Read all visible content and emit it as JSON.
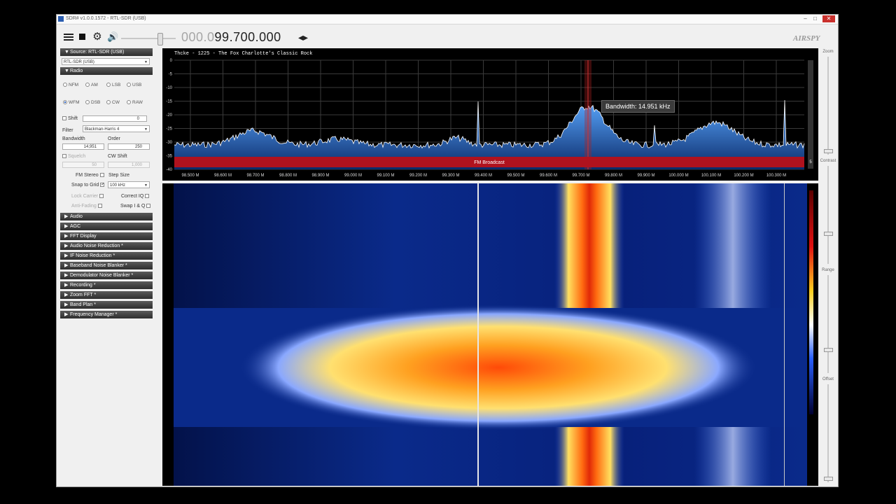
{
  "window": {
    "title": "SDR# v1.0.0.1572 - RTL-SDR (USB)",
    "minimize": "–",
    "maximize": "□",
    "close": "✕"
  },
  "toolbar": {
    "freq_dim": "000.0",
    "freq_bright": "99.700.000",
    "freq_arrows": "◂▸",
    "gear": "⚙",
    "speaker": "🔊"
  },
  "logo": "AIRSPY",
  "source": {
    "header": "Source: RTL-SDR (USB)",
    "selected": "RTL-SDR (USB)"
  },
  "radio": {
    "header": "Radio",
    "modes": [
      "NFM",
      "AM",
      "LSB",
      "USB",
      "WFM",
      "DSB",
      "CW",
      "RAW"
    ],
    "selected_mode": "WFM",
    "shift_label": "Shift",
    "shift_value": "0",
    "filter_label": "Filter",
    "filter_value": "Blackman-Harris 4",
    "bandwidth_label": "Bandwidth",
    "bandwidth_value": "14,951",
    "order_label": "Order",
    "order_value": "250",
    "squelch_label": "Squelch",
    "squelch_value": "50",
    "cw_shift_label": "CW Shift",
    "cw_shift_value": "1,000",
    "fm_stereo_label": "FM Stereo",
    "step_size_label": "Step Size",
    "snap_label": "Snap to Grid",
    "snap_value": "100 kHz",
    "lock_carrier_label": "Lock Carrier",
    "correct_iq_label": "Correct IQ",
    "anti_fading_label": "Anti-Fading",
    "swap_iq_label": "Swap I & Q"
  },
  "plugins": [
    "Audio",
    "AGC",
    "FFT Display",
    "Audio Noise Reduction *",
    "IF Noise Reduction *",
    "Baseband Noise Blanker *",
    "Demodulator Noise Blanker *",
    "Recording *",
    "Zoom FFT *",
    "Band Plan *",
    "Frequency Manager *"
  ],
  "spectrum": {
    "rds": "Thcke    - 1225 - The Fox Charlotte's Classic Rock",
    "tooltip": "Bandwidth: 14.951 kHz",
    "band_label": "FM Broadcast",
    "y_ticks": [
      "0",
      "-5",
      "-10",
      "-15",
      "-20",
      "-25",
      "-30",
      "-35",
      "-40"
    ],
    "x_ticks": [
      "98.500 M",
      "98.600 M",
      "98.700 M",
      "98.800 M",
      "98.900 M",
      "99.000 M",
      "99.100 M",
      "99.200 M",
      "99.300 M",
      "99.400 M",
      "99.500 M",
      "99.600 M",
      "99.700 M",
      "99.800 M",
      "99.900 M",
      "100.000 M",
      "100.100 M",
      "100.200 M",
      "100.300 M"
    ],
    "corner_value": "5"
  },
  "right_panel": {
    "zoom": "Zoom",
    "contrast": "Contrast",
    "range": "Range",
    "offset": "Offset"
  },
  "colors": {
    "accent": "#2a60c0",
    "band_bar": "#b0121e",
    "spectrum_fill": "#1e5fb0"
  }
}
